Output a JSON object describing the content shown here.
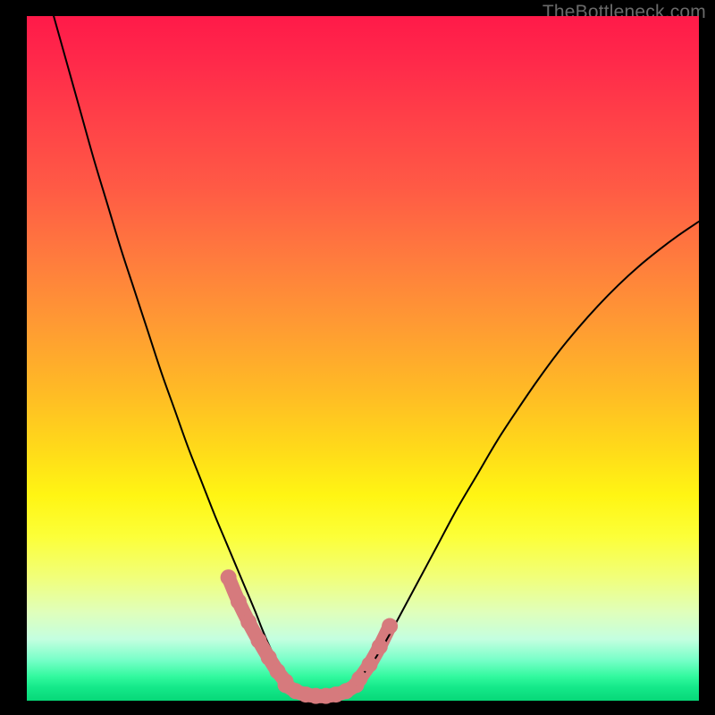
{
  "watermark": {
    "text": "TheBottleneck.com"
  },
  "chart_data": {
    "type": "line",
    "title": "",
    "xlabel": "",
    "ylabel": "",
    "xlim": [
      0,
      100
    ],
    "ylim": [
      0,
      100
    ],
    "grid": false,
    "legend": false,
    "series": [
      {
        "name": "left-curve",
        "kind": "thin",
        "x": [
          4,
          6,
          8,
          10,
          12,
          14,
          16,
          18,
          20,
          22,
          24,
          26,
          28,
          29.5,
          31,
          32.5,
          34,
          35,
          36,
          37,
          38,
          39,
          40
        ],
        "y": [
          100,
          93,
          86,
          79,
          72.5,
          66,
          60,
          54,
          48,
          42.5,
          37,
          32,
          27,
          23.5,
          20,
          16.5,
          13,
          10.5,
          8.2,
          6.2,
          4.5,
          3.1,
          2.1
        ]
      },
      {
        "name": "valley-left-thick",
        "kind": "thick",
        "x": [
          30,
          31.5,
          33,
          34.5,
          36,
          37.3,
          38.5
        ],
        "y": [
          18,
          14.5,
          11.5,
          8.8,
          6.3,
          4.3,
          2.8
        ]
      },
      {
        "name": "valley-bottom-thick",
        "kind": "thick",
        "x": [
          38.5,
          40,
          41.5,
          43,
          44.5,
          46,
          47.5,
          49
        ],
        "y": [
          2.3,
          1.4,
          0.9,
          0.7,
          0.7,
          0.9,
          1.4,
          2.3
        ]
      },
      {
        "name": "valley-right-thick",
        "kind": "thick",
        "x": [
          49.5,
          51,
          52.5,
          54
        ],
        "y": [
          3.2,
          5.3,
          7.9,
          10.9
        ]
      },
      {
        "name": "right-curve",
        "kind": "thin",
        "x": [
          47,
          49,
          51,
          53,
          55,
          58,
          61,
          64,
          67,
          70,
          73,
          76,
          79,
          82,
          85,
          88,
          91,
          94,
          97,
          100
        ],
        "y": [
          1.5,
          3,
          5,
          8,
          11.5,
          17,
          22.5,
          28,
          33,
          38,
          42.5,
          46.8,
          50.8,
          54.4,
          57.7,
          60.7,
          63.4,
          65.8,
          68,
          70
        ]
      }
    ],
    "colors": {
      "thin_line": "#000000",
      "thick_line": "#d67a7d"
    }
  }
}
